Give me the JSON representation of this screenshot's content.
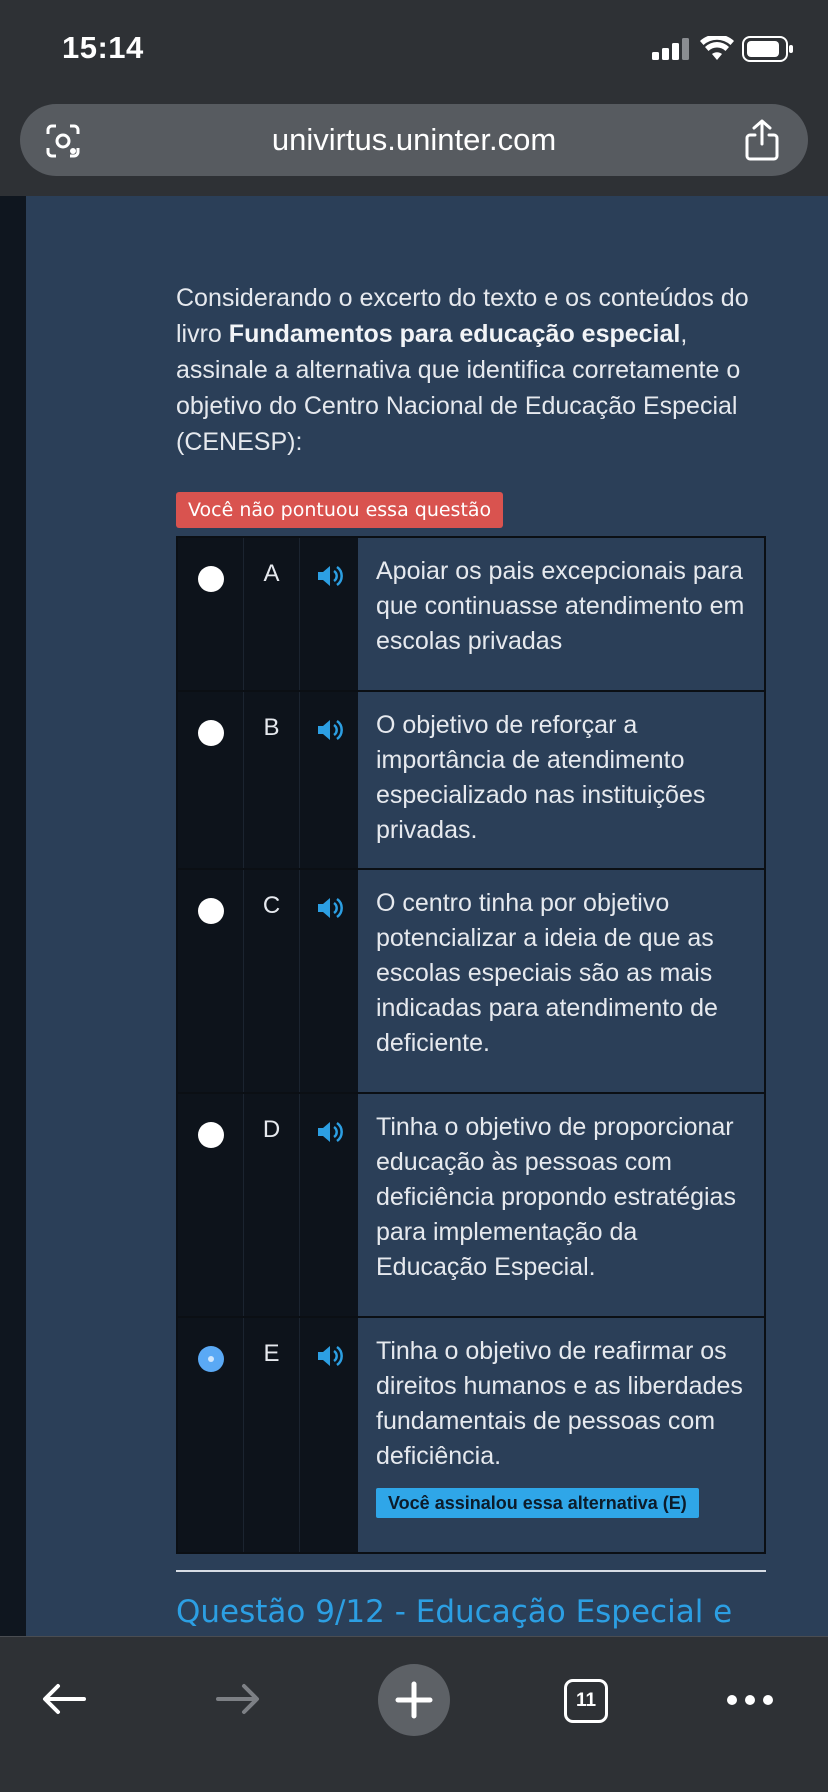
{
  "status_bar": {
    "time": "15:14"
  },
  "browser": {
    "url": "univirtus.uninter.com",
    "tab_count": "11"
  },
  "question": {
    "text_before": "Considerando o excerto do texto e os conteúdos do livro ",
    "text_bold": "Fundamentos para educação especial",
    "text_after": ", assinale a alternativa que identifica corretamente o objetivo do Centro Nacional  de Educação Especial (CENESP):",
    "result_badge": "Você não pontuou essa questão"
  },
  "options": [
    {
      "letter": "A",
      "text": "Apoiar os pais excepcionais para que continuasse atendimento em escolas privadas",
      "selected": false
    },
    {
      "letter": "B",
      "text": "O objetivo de reforçar a importância de atendimento especializado nas instituições privadas.",
      "selected": false
    },
    {
      "letter": "C",
      "text": "O centro tinha por objetivo potencializar a ideia de que as escolas especiais são as mais indicadas para atendimento de deficiente.",
      "selected": false
    },
    {
      "letter": "D",
      "text": "Tinha o objetivo de proporcionar educação às pessoas com deficiência propondo estratégias para implementação da Educação Especial.",
      "selected": false
    },
    {
      "letter": "E",
      "text": "Tinha o objetivo de reafirmar os direitos humanos e as liberdades fundamentais de pessoas com deficiência.",
      "selected": true,
      "badge": "Você assinalou essa alternativa (E)"
    }
  ],
  "next_question_title": "Questão 9/12 - Educação Especial e",
  "colors": {
    "page_bg": "#2b3f58",
    "wrong_badge": "#d9534f",
    "selected_badge": "#2fa6e8",
    "link": "#2c9fe3"
  }
}
